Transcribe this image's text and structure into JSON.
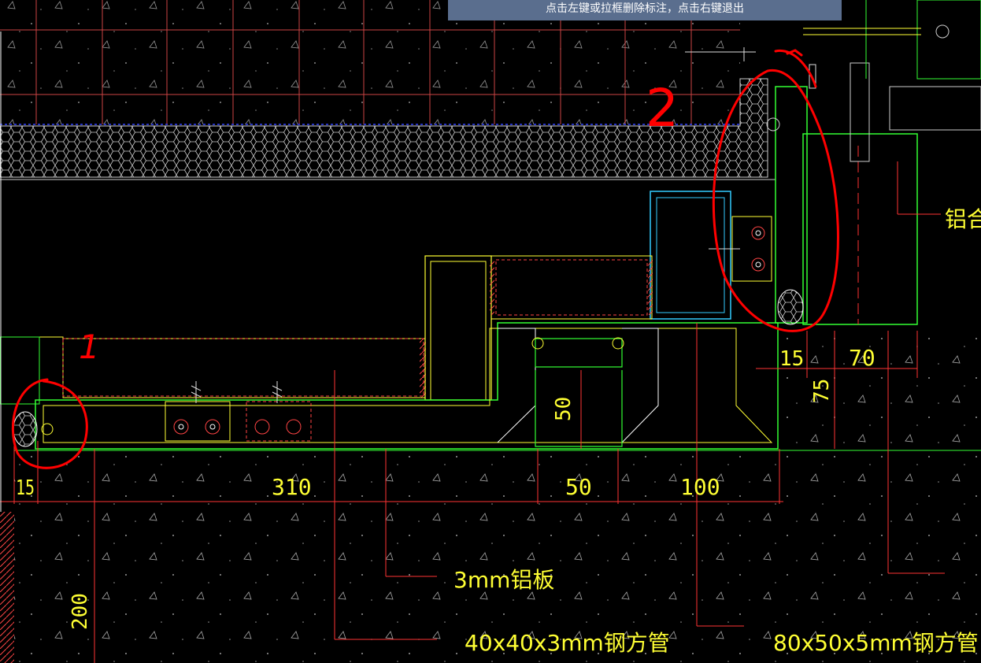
{
  "status_hint": "点击左键或拉框删除标注，点击右键退出",
  "dimensions": {
    "d15_left": "15",
    "d310": "310",
    "d50_h": "50",
    "d100": "100",
    "d50_v": "50",
    "d200": "200",
    "d15_right": "15",
    "d70": "70",
    "d75": "75"
  },
  "callouts": {
    "aluminum_plate": "3mm铝板",
    "steel_tube_small": "40x40x3mm钢方管",
    "steel_tube_large": "80x50x5mm钢方管",
    "aluminum_alloy": "铝合金"
  },
  "markup": {
    "mark_1": "1",
    "mark_2": "2"
  },
  "colors": {
    "background": "#000000",
    "dimension_text": "#ffff33",
    "profile_green": "#33ff33",
    "profile_yellow": "#ffff33",
    "tube_cyan": "#33ccff",
    "dimension_line": "#ff3333",
    "annotation_red": "#ff0000",
    "hint_bar": "#5a6e8e"
  }
}
